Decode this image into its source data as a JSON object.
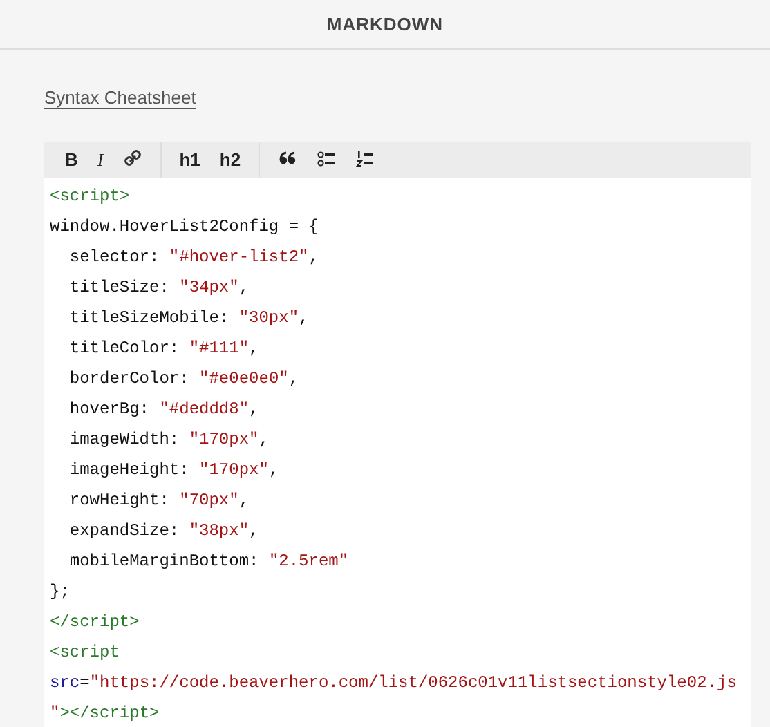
{
  "header": {
    "title": "MARKDOWN"
  },
  "cheatsheet_link": "Syntax Cheatsheet",
  "toolbar": [
    {
      "kind": "bold",
      "label": "B"
    },
    {
      "kind": "italic",
      "label": "I"
    },
    {
      "kind": "link"
    },
    {
      "kind": "divider"
    },
    {
      "kind": "heading",
      "label": "h1"
    },
    {
      "kind": "heading",
      "label": "h2"
    },
    {
      "kind": "divider"
    },
    {
      "kind": "quote"
    },
    {
      "kind": "bullets"
    },
    {
      "kind": "numbers"
    }
  ],
  "code_lines": [
    [
      {
        "kind": "tag",
        "text": "<script>"
      }
    ],
    [
      {
        "kind": "plain",
        "text": "window.HoverList2Config = {"
      }
    ],
    [
      {
        "kind": "plain",
        "text": "  selector: "
      },
      {
        "kind": "string",
        "text": "\"#hover-list2\""
      },
      {
        "kind": "plain",
        "text": ","
      }
    ],
    [
      {
        "kind": "plain",
        "text": "  titleSize: "
      },
      {
        "kind": "string",
        "text": "\"34px\""
      },
      {
        "kind": "plain",
        "text": ","
      }
    ],
    [
      {
        "kind": "plain",
        "text": "  titleSizeMobile: "
      },
      {
        "kind": "string",
        "text": "\"30px\""
      },
      {
        "kind": "plain",
        "text": ","
      }
    ],
    [
      {
        "kind": "plain",
        "text": "  titleColor: "
      },
      {
        "kind": "string",
        "text": "\"#111\""
      },
      {
        "kind": "plain",
        "text": ","
      }
    ],
    [
      {
        "kind": "plain",
        "text": "  borderColor: "
      },
      {
        "kind": "string",
        "text": "\"#e0e0e0\""
      },
      {
        "kind": "plain",
        "text": ","
      }
    ],
    [
      {
        "kind": "plain",
        "text": "  hoverBg: "
      },
      {
        "kind": "string",
        "text": "\"#deddd8\""
      },
      {
        "kind": "plain",
        "text": ","
      }
    ],
    [
      {
        "kind": "plain",
        "text": "  imageWidth: "
      },
      {
        "kind": "string",
        "text": "\"170px\""
      },
      {
        "kind": "plain",
        "text": ","
      }
    ],
    [
      {
        "kind": "plain",
        "text": "  imageHeight: "
      },
      {
        "kind": "string",
        "text": "\"170px\""
      },
      {
        "kind": "plain",
        "text": ","
      }
    ],
    [
      {
        "kind": "plain",
        "text": "  rowHeight: "
      },
      {
        "kind": "string",
        "text": "\"70px\""
      },
      {
        "kind": "plain",
        "text": ","
      }
    ],
    [
      {
        "kind": "plain",
        "text": "  expandSize: "
      },
      {
        "kind": "string",
        "text": "\"38px\""
      },
      {
        "kind": "plain",
        "text": ","
      }
    ],
    [
      {
        "kind": "plain",
        "text": "  mobileMarginBottom: "
      },
      {
        "kind": "string",
        "text": "\"2.5rem\""
      }
    ],
    [
      {
        "kind": "plain",
        "text": "};"
      }
    ],
    [
      {
        "kind": "tag",
        "text": "</script>"
      }
    ],
    [
      {
        "kind": "tag",
        "text": "<script"
      }
    ],
    [
      {
        "kind": "attr",
        "text": "src"
      },
      {
        "kind": "plain",
        "text": "="
      },
      {
        "kind": "string",
        "text": "\"https://code.beaverhero.com/list/0626c01v11listsectionstyle02.js"
      }
    ],
    [
      {
        "kind": "string",
        "text": "\""
      },
      {
        "kind": "tag",
        "text": "></script>"
      }
    ]
  ]
}
